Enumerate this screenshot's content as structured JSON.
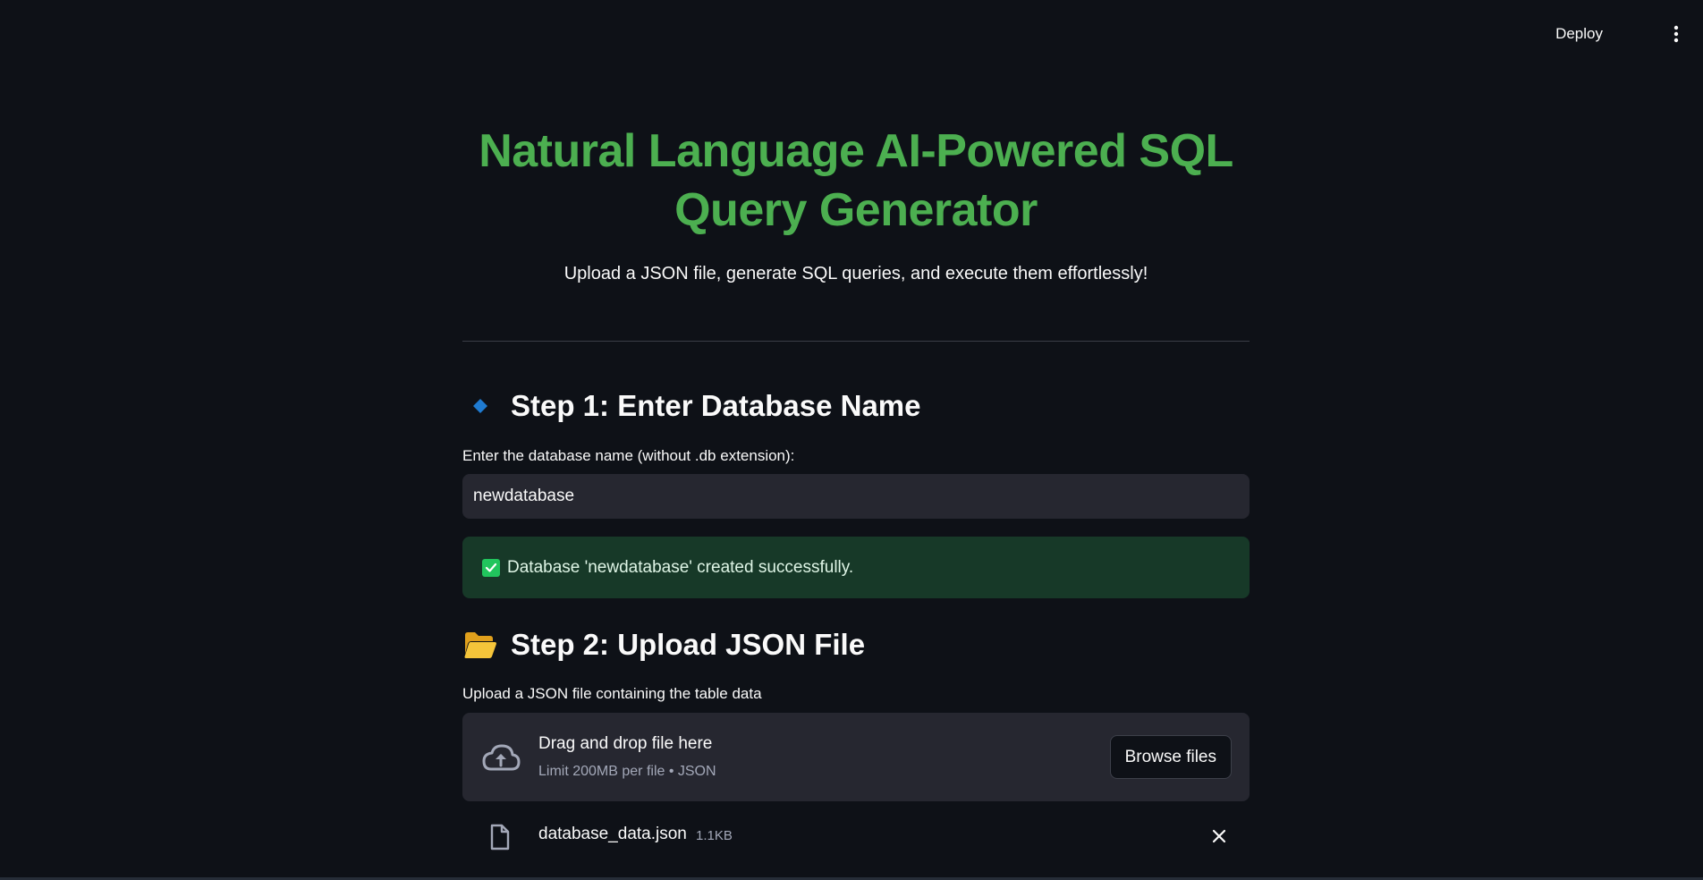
{
  "header": {
    "deploy_label": "Deploy",
    "menu_icon": "vertical-ellipsis-icon"
  },
  "main": {
    "title": "Natural Language AI-Powered SQL Query Generator",
    "subtitle": "Upload a JSON file, generate SQL queries, and execute them effortlessly!",
    "step1": {
      "icon": "blue-diamond-icon",
      "heading": "Step 1: Enter Database Name",
      "input_label": "Enter the database name (without .db extension):",
      "input_value": "newdatabase",
      "success_message": "Database 'newdatabase' created successfully."
    },
    "step2": {
      "icon": "open-folder-icon",
      "heading": "Step 2: Upload JSON File",
      "uploader_label": "Upload a JSON file containing the table data",
      "dropzone_title": "Drag and drop file here",
      "dropzone_limit": "Limit 200MB per file • JSON",
      "browse_label": "Browse files",
      "uploaded_file": {
        "name": "database_data.json",
        "size": "1.1KB"
      }
    }
  },
  "colors": {
    "background": "#0e1117",
    "title": "#4caf50",
    "input_bg": "#262730",
    "success_bg": "#173928",
    "success_check": "#21c55d",
    "diamond": "#1f7bd1",
    "folder": "#f5b82e"
  }
}
